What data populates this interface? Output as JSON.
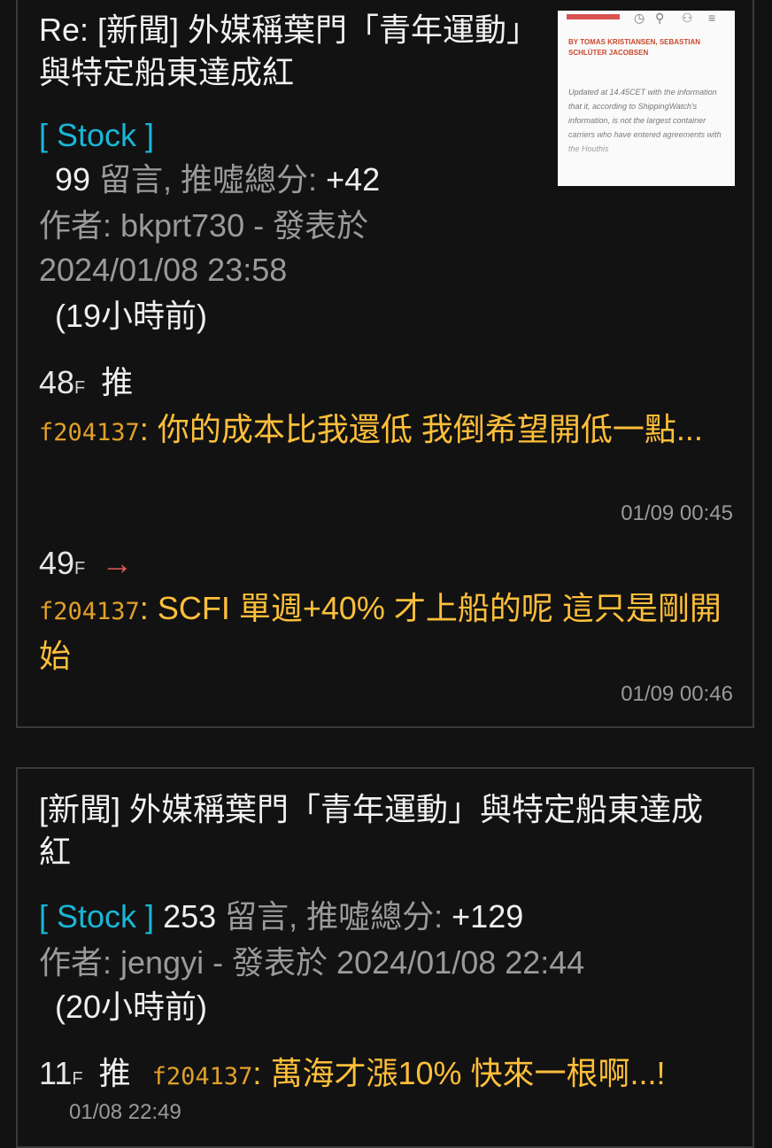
{
  "post1": {
    "title": "Re: [新聞] 外媒稱葉門「青年運動」與特定船東達成紅",
    "board": "[ Stock ]",
    "comments_count": "99",
    "comments_label": " 留言, 推噓總分: ",
    "score": "+42",
    "author_line": "作者: bkprt730 - 發表於",
    "posted_date": "2024/01/08 23:58",
    "posted_ago": "(19小時前)",
    "thumbnail": {
      "byline": "BY TOMAS KRISTIANSEN, SEBASTIAN SCHLÜTER JACOBSEN",
      "body": "Updated at 14.45CET with the information that it, according to ShippingWatch's information, is not the largest container carriers who have entered agreements with the Houthis"
    },
    "comments": [
      {
        "floor": "48",
        "floor_suffix": "F",
        "tag": "推",
        "user": "f204137",
        "text": "你的成本比我還低 我倒希望開低一點...",
        "time": "01/09 00:45"
      },
      {
        "floor": "49",
        "floor_suffix": "F",
        "tag": "→",
        "user": "f204137",
        "text": "SCFI 單週+40% 才上船的呢 這只是剛開始",
        "time": "01/09 00:46"
      }
    ]
  },
  "post2": {
    "title": "[新聞] 外媒稱葉門「青年運動」與特定船東達成紅",
    "board": "[ Stock ]",
    "comments_count": "253",
    "comments_label": " 留言, 推噓總分: ",
    "score": "+129",
    "author_line": "作者: jengyi - 發表於 2024/01/08 22:44",
    "posted_ago": "(20小時前)",
    "comment": {
      "floor": "11",
      "floor_suffix": "F",
      "tag": "推",
      "user": "f204137",
      "text": "萬海才漲10% 快來一根啊...!",
      "time": "01/08 22:49"
    }
  },
  "colors": {
    "background": "#111111",
    "board": "#19b6d6",
    "comment": "#ffbf3a",
    "arrow": "#e05858",
    "muted": "#9a9a9a"
  }
}
